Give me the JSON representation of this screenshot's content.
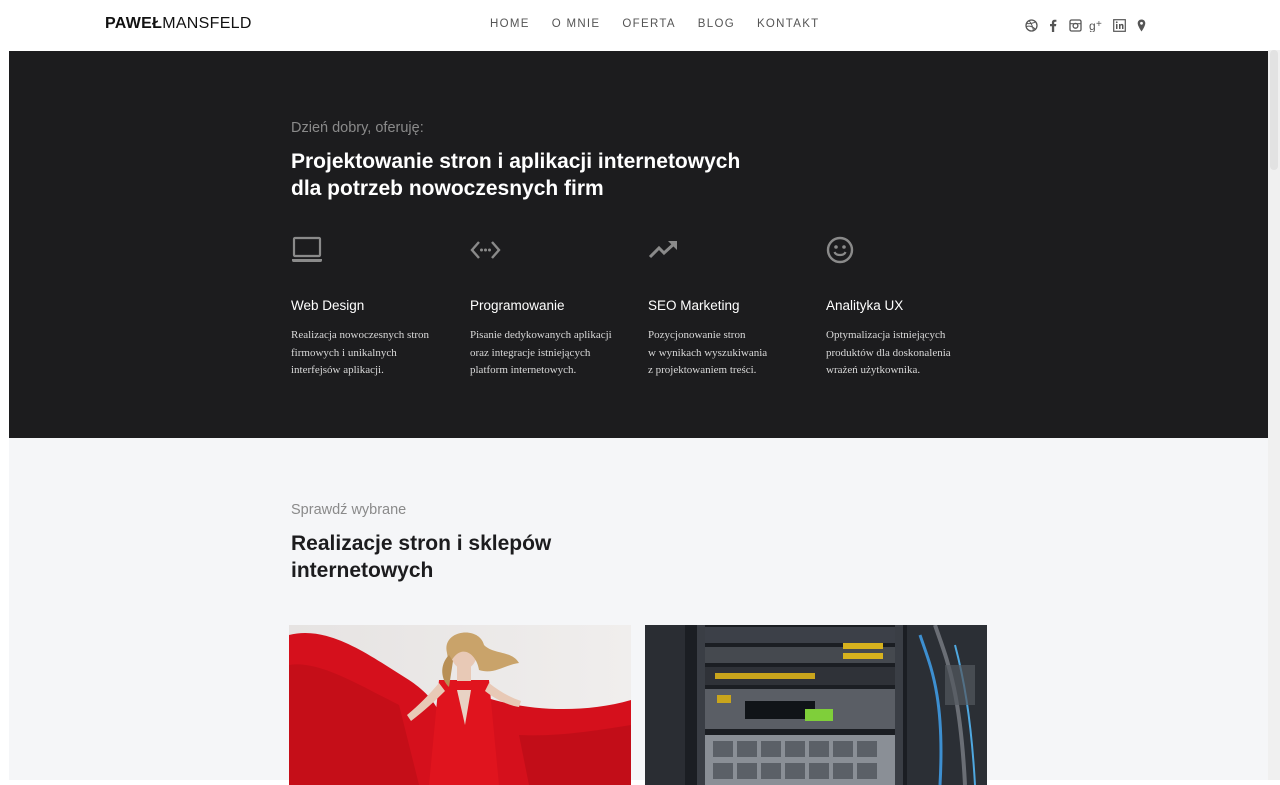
{
  "header": {
    "logo_first": "PAWEŁ",
    "logo_last": "MANSFELD",
    "nav": [
      "HOME",
      "O MNIE",
      "OFERTA",
      "BLOG",
      "KONTAKT"
    ],
    "social_icons": [
      "dribbble-icon",
      "facebook-icon",
      "instagram-icon",
      "google-plus-icon",
      "linkedin-icon",
      "location-pin-icon"
    ]
  },
  "hero": {
    "eyebrow": "Dzień dobry, oferuję:",
    "headline_line1": "Projektowanie stron i aplikacji internetowych",
    "headline_line2": "dla potrzeb nowoczesnych firm",
    "services": [
      {
        "icon": "laptop-icon",
        "title": "Web Design",
        "desc": [
          "Realizacja nowoczesnych stron",
          "firmowych i unikalnych",
          "interfejsów aplikacji."
        ]
      },
      {
        "icon": "code-icon",
        "title": "Programowanie",
        "desc": [
          "Pisanie dedykowanych aplikacji",
          "oraz integracje istniejących",
          "platform internetowych."
        ]
      },
      {
        "icon": "trending-up-icon",
        "title": "SEO Marketing",
        "desc": [
          "Pozycjonowanie stron",
          "w wynikach wyszukiwania",
          "z projektowaniem treści."
        ]
      },
      {
        "icon": "smiley-icon",
        "title": "Analityka UX",
        "desc": [
          "Optymalizacja istniejących",
          "produktów dla doskonalenia",
          "wrażeń użytkownika."
        ]
      }
    ]
  },
  "portfolio": {
    "eyebrow": "Sprawdź wybrane",
    "headline_line1": "Realizacje stron i sklepów",
    "headline_line2": "internetowych"
  },
  "colors": {
    "dark_bg": "#1c1c1e",
    "light_bg": "#f5f6f8",
    "accent_red": "#e0141e"
  }
}
